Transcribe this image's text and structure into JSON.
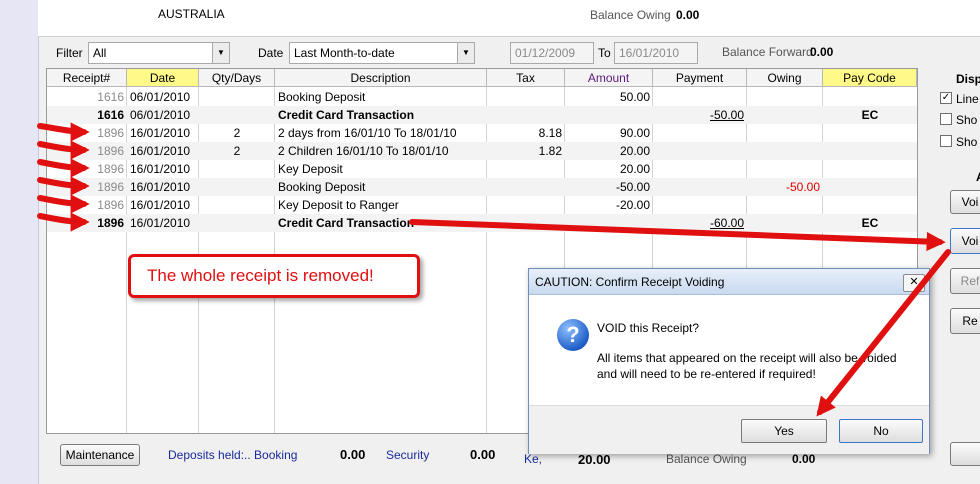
{
  "top": {
    "country": "AUSTRALIA",
    "balance_owing_label": "Balance Owing",
    "balance_owing_value": "0.00"
  },
  "filter_bar": {
    "filter_label": "Filter",
    "filter_value": "All",
    "date_label": "Date",
    "date_value": "Last Month-to-date",
    "date_from": "01/12/2009",
    "to_label": "To",
    "date_to": "16/01/2010",
    "balance_forward_label": "Balance Forward",
    "balance_forward_value": "0.00"
  },
  "grid": {
    "headers": [
      "Receipt#",
      "Date",
      "Qty/Days",
      "Description",
      "Tax",
      "Amount",
      "Payment",
      "Owing",
      "Pay Code"
    ],
    "rows": [
      {
        "receipt": "1616",
        "date": "06/01/2010",
        "qty": "",
        "desc": "Booking Deposit",
        "tax": "",
        "amount": "50.00",
        "payment": "",
        "owing": "",
        "paycode": ""
      },
      {
        "receipt": "1616",
        "date": "06/01/2010",
        "qty": "",
        "desc": "Credit Card Transaction",
        "tax": "",
        "amount": "",
        "payment": "-50.00",
        "owing": "",
        "paycode": "EC"
      },
      {
        "receipt": "1896",
        "date": "16/01/2010",
        "qty": "2",
        "desc": "2 days from 16/01/10 To 18/01/10",
        "tax": "8.18",
        "amount": "90.00",
        "payment": "",
        "owing": "",
        "paycode": ""
      },
      {
        "receipt": "1896",
        "date": "16/01/2010",
        "qty": "2",
        "desc": "2 Children 16/01/10 To 18/01/10",
        "tax": "1.82",
        "amount": "20.00",
        "payment": "",
        "owing": "",
        "paycode": ""
      },
      {
        "receipt": "1896",
        "date": "16/01/2010",
        "qty": "",
        "desc": "Key Deposit",
        "tax": "",
        "amount": "20.00",
        "payment": "",
        "owing": "",
        "paycode": ""
      },
      {
        "receipt": "1896",
        "date": "16/01/2010",
        "qty": "",
        "desc": "Booking Deposit",
        "tax": "",
        "amount": "-50.00",
        "payment": "",
        "owing": "-50.00",
        "paycode": ""
      },
      {
        "receipt": "1896",
        "date": "16/01/2010",
        "qty": "",
        "desc": "Key Deposit to Ranger",
        "tax": "",
        "amount": "-20.00",
        "payment": "",
        "owing": "",
        "paycode": ""
      },
      {
        "receipt": "1896",
        "date": "16/01/2010",
        "qty": "",
        "desc": "Credit Card Transaction",
        "tax": "",
        "amount": "",
        "payment": "-60.00",
        "owing": "",
        "paycode": "EC"
      }
    ]
  },
  "right_panel": {
    "display_label": "Disp",
    "checks": [
      "Line",
      "Sho",
      "Sho"
    ],
    "a_label": "A",
    "buttons": [
      "Voi",
      "Voi",
      "Ref",
      "Re"
    ]
  },
  "annotation": {
    "callout_text": "The whole receipt is removed!",
    "accent_color": "#e01010"
  },
  "dialog": {
    "title": "CAUTION: Confirm Receipt Voiding",
    "close_glyph": "✕",
    "question": "VOID this Receipt?",
    "message_line1": "All items that appeared on the receipt will also be voided",
    "message_line2": "and will need to be re-entered if required!",
    "icon_glyph": "?",
    "yes_label": "Yes",
    "no_label": "No"
  },
  "bottom": {
    "maintenance_label": "Maintenance",
    "deposits_label": "Deposits held:.. Booking",
    "booking_value": "0.00",
    "security_label": "Security",
    "security_value": "0.00",
    "partial_label": "Ke,",
    "partial_value": "20.00",
    "balance_label": "Balance Owing",
    "balance_value": "0.00"
  }
}
